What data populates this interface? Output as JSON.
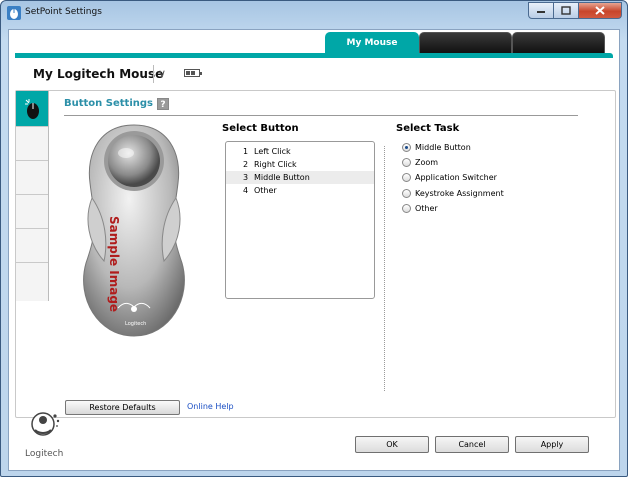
{
  "window": {
    "title": "SetPoint Settings"
  },
  "tabs": [
    {
      "label": "My Mouse",
      "active": true
    },
    {
      "label": "",
      "active": false
    },
    {
      "label": "",
      "active": false
    }
  ],
  "device": {
    "name": "My Logitech Mouse"
  },
  "section": {
    "title": "Button Settings",
    "help": "?"
  },
  "image": {
    "label": "Sample Image",
    "brand": "Logitech"
  },
  "select_button": {
    "title": "Select Button",
    "items": [
      {
        "num": "1",
        "label": "Left Click"
      },
      {
        "num": "2",
        "label": "Right Click"
      },
      {
        "num": "3",
        "label": "Middle Button"
      },
      {
        "num": "4",
        "label": "Other"
      }
    ],
    "selected_index": 2
  },
  "select_task": {
    "title": "Select Task",
    "options": [
      "Middle Button",
      "Zoom",
      "Application Switcher",
      "Keystroke Assignment",
      "Other"
    ],
    "selected": "Middle Button"
  },
  "actions": {
    "restore": "Restore Defaults",
    "online_help": "Online Help"
  },
  "dialog_buttons": {
    "ok": "OK",
    "cancel": "Cancel",
    "apply": "Apply"
  },
  "brand": {
    "logo_text": "Logitech"
  },
  "colors": {
    "accent": "#00a7a7",
    "title_blue": "#2b8fa8",
    "link": "#1b4fc4",
    "sample_red": "#b01c1c"
  }
}
